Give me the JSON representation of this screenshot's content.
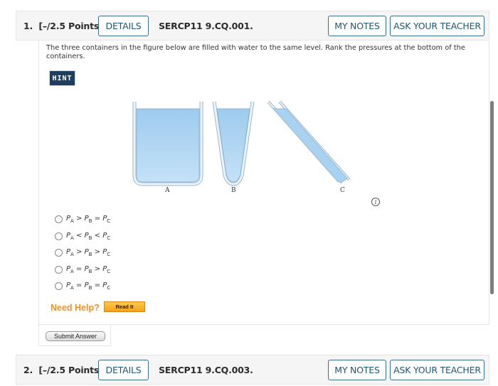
{
  "questions": [
    {
      "number": "1.",
      "points": "[–/2.5 Points]",
      "details_label": "DETAILS",
      "code": "SERCP11 9.CQ.001.",
      "my_notes_label": "MY NOTES",
      "ask_teacher_label": "ASK YOUR TEACHER",
      "text": "The three containers in the figure below are filled with water to the same level. Rank the pressures at the bottom of the containers.",
      "hint_label": "HINT",
      "figure": {
        "labels": [
          "A",
          "B",
          "C"
        ],
        "info_icon": "i"
      },
      "options": [
        {
          "p1": "A",
          "op1": ">",
          "p2": "B",
          "op2": "=",
          "p3": "C"
        },
        {
          "p1": "A",
          "op1": "<",
          "p2": "B",
          "op2": "<",
          "p3": "C"
        },
        {
          "p1": "A",
          "op1": ">",
          "p2": "B",
          "op2": ">",
          "p3": "C"
        },
        {
          "p1": "A",
          "op1": "=",
          "p2": "B",
          "op2": ">",
          "p3": "C"
        },
        {
          "p1": "A",
          "op1": "=",
          "p2": "B",
          "op2": "=",
          "p3": "C"
        }
      ],
      "option_symbol": "P",
      "need_help_label": "Need Help?",
      "read_it_label": "Read It",
      "submit_label": "Submit Answer"
    },
    {
      "number": "2.",
      "points": "[–/2.5 Points]",
      "details_label": "DETAILS",
      "code": "SERCP11 9.CQ.003.",
      "my_notes_label": "MY NOTES",
      "ask_teacher_label": "ASK YOUR TEACHER"
    }
  ],
  "colors": {
    "accent": "#1f5670",
    "hint_bg": "#1d3e5e",
    "need_help": "#e8922b",
    "water": "#a9d2f0"
  }
}
